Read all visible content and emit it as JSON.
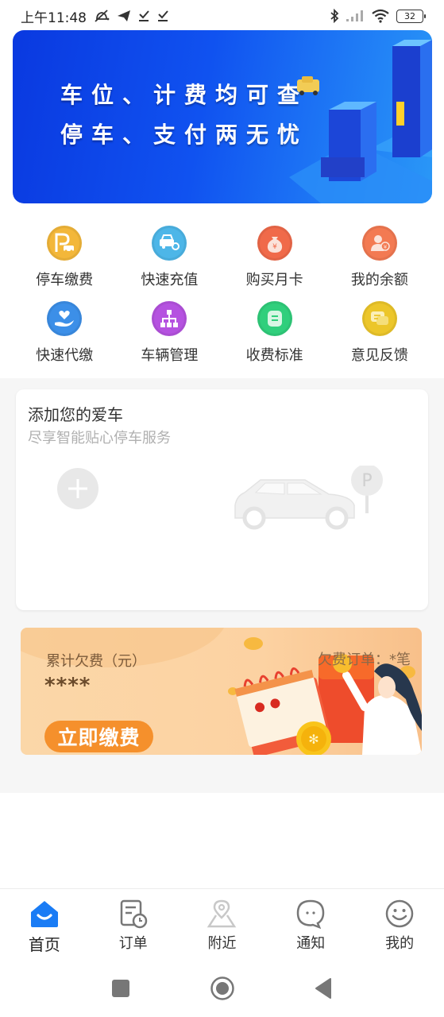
{
  "status_bar": {
    "time": "上午11:48",
    "icons_left": [
      "mute-alarm-icon",
      "telegram-icon",
      "download-icon",
      "download-icon"
    ],
    "icons_right": [
      "bluetooth-icon",
      "signal-icon",
      "wifi-icon",
      "battery-icon"
    ],
    "battery": "32"
  },
  "banner": {
    "line1": "车位、计费均可查",
    "line2": "停车、支付两无忧"
  },
  "menu": {
    "items": [
      {
        "label": "停车缴费",
        "icon": "parking-pay-icon",
        "color": "#f3b73a"
      },
      {
        "label": "快速充值",
        "icon": "car-recharge-icon",
        "color": "#4db6e8"
      },
      {
        "label": "购买月卡",
        "icon": "money-bag-icon",
        "color": "#f06a4a"
      },
      {
        "label": "我的余额",
        "icon": "user-balance-icon",
        "color": "#f37a52"
      },
      {
        "label": "快速代缴",
        "icon": "heart-hand-icon",
        "color": "#3c8fe8"
      },
      {
        "label": "车辆管理",
        "icon": "org-chart-icon",
        "color": "#b552e0"
      },
      {
        "label": "收费标准",
        "icon": "message-doc-icon",
        "color": "#30cf7c"
      },
      {
        "label": "意见反馈",
        "icon": "feedback-chat-icon",
        "color": "#ecc62a"
      }
    ]
  },
  "car_card": {
    "title": "添加您的爱车",
    "subtitle": "尽享智能贴心停车服务",
    "parking_sign": "P"
  },
  "arrears": {
    "label": "累计欠费（元）",
    "amount": "****",
    "orders": "欠费订单：*笔",
    "pay_button": "立即缴费"
  },
  "tabbar": {
    "tabs": [
      {
        "label": "首页",
        "icon": "home-icon",
        "active": true
      },
      {
        "label": "订单",
        "icon": "order-icon",
        "active": false
      },
      {
        "label": "附近",
        "icon": "location-icon",
        "active": false
      },
      {
        "label": "通知",
        "icon": "chat-icon",
        "active": false
      },
      {
        "label": "我的",
        "icon": "smile-icon",
        "active": false
      }
    ],
    "active_color": "#1a7cf5"
  },
  "navbar": {
    "buttons": [
      "recents-button",
      "home-button",
      "back-button"
    ]
  }
}
